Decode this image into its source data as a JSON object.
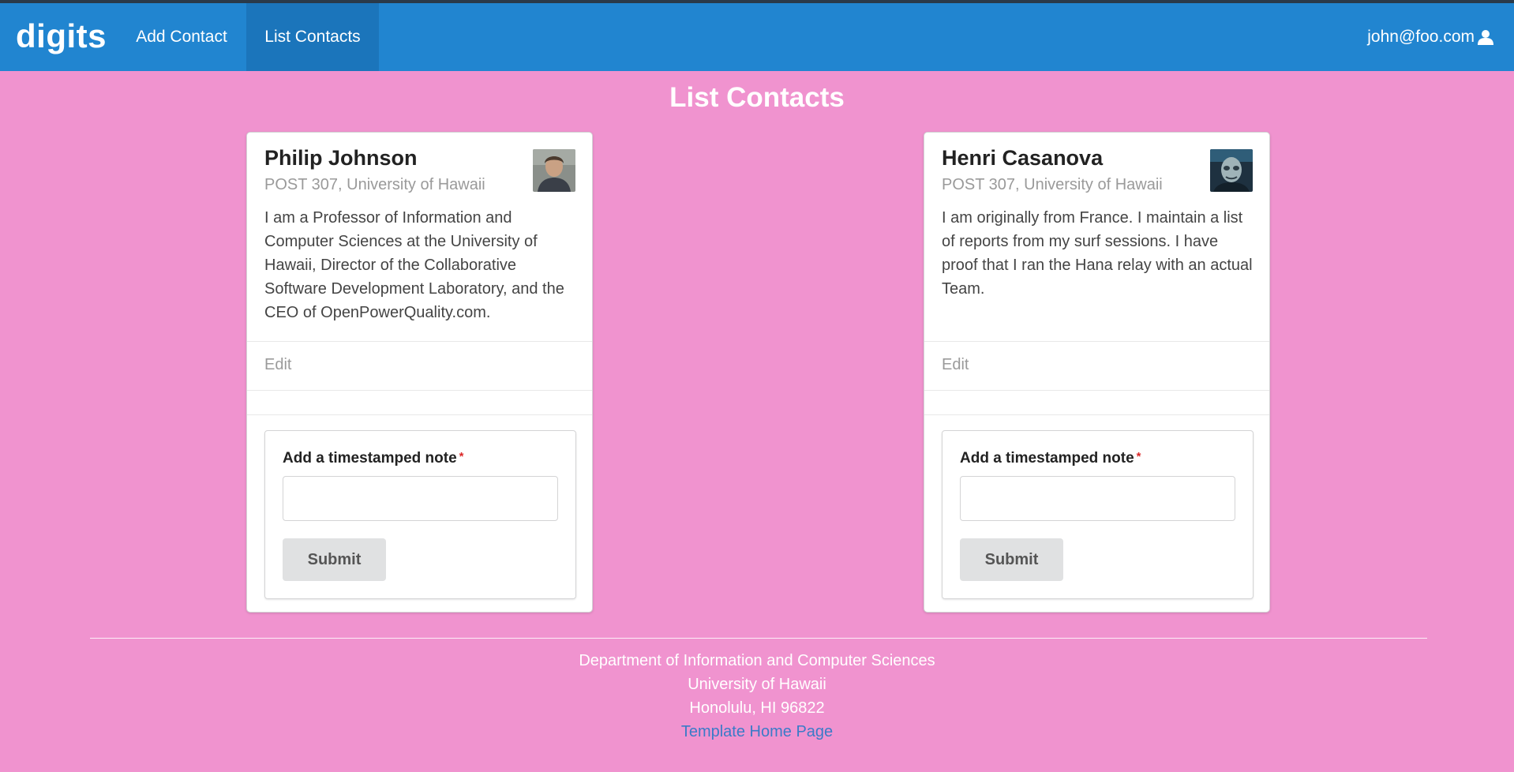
{
  "navbar": {
    "brand": "digits",
    "items": [
      {
        "label": "Add Contact",
        "active": false
      },
      {
        "label": "List Contacts",
        "active": true
      }
    ],
    "user": "john@foo.com",
    "user_icon": "user-icon",
    "color": "#2185D0",
    "active_color": "#1B75BB"
  },
  "page": {
    "title": "List Contacts",
    "background": "#F093CF"
  },
  "contacts": [
    {
      "name": "Philip Johnson",
      "address": "POST 307, University of Hawaii",
      "description": "I am a Professor of Information and Computer Sciences at the University of Hawaii, Director of the Collaborative Software Development Laboratory, and the CEO of OpenPowerQuality.com.",
      "edit_label": "Edit",
      "note_form": {
        "label": "Add a timestamped note",
        "required_mark": "*",
        "value": "",
        "submit_label": "Submit"
      }
    },
    {
      "name": "Henri Casanova",
      "address": "POST 307, University of Hawaii",
      "description": "I am originally from France. I maintain a list of reports from my surf sessions. I have proof that I ran the Hana relay with an actual Team.",
      "edit_label": "Edit",
      "note_form": {
        "label": "Add a timestamped note",
        "required_mark": "*",
        "value": "",
        "submit_label": "Submit"
      }
    }
  ],
  "footer": {
    "lines": [
      "Department of Information and Computer Sciences",
      "University of Hawaii",
      "Honolulu, HI 96822"
    ],
    "link": "Template Home Page"
  }
}
